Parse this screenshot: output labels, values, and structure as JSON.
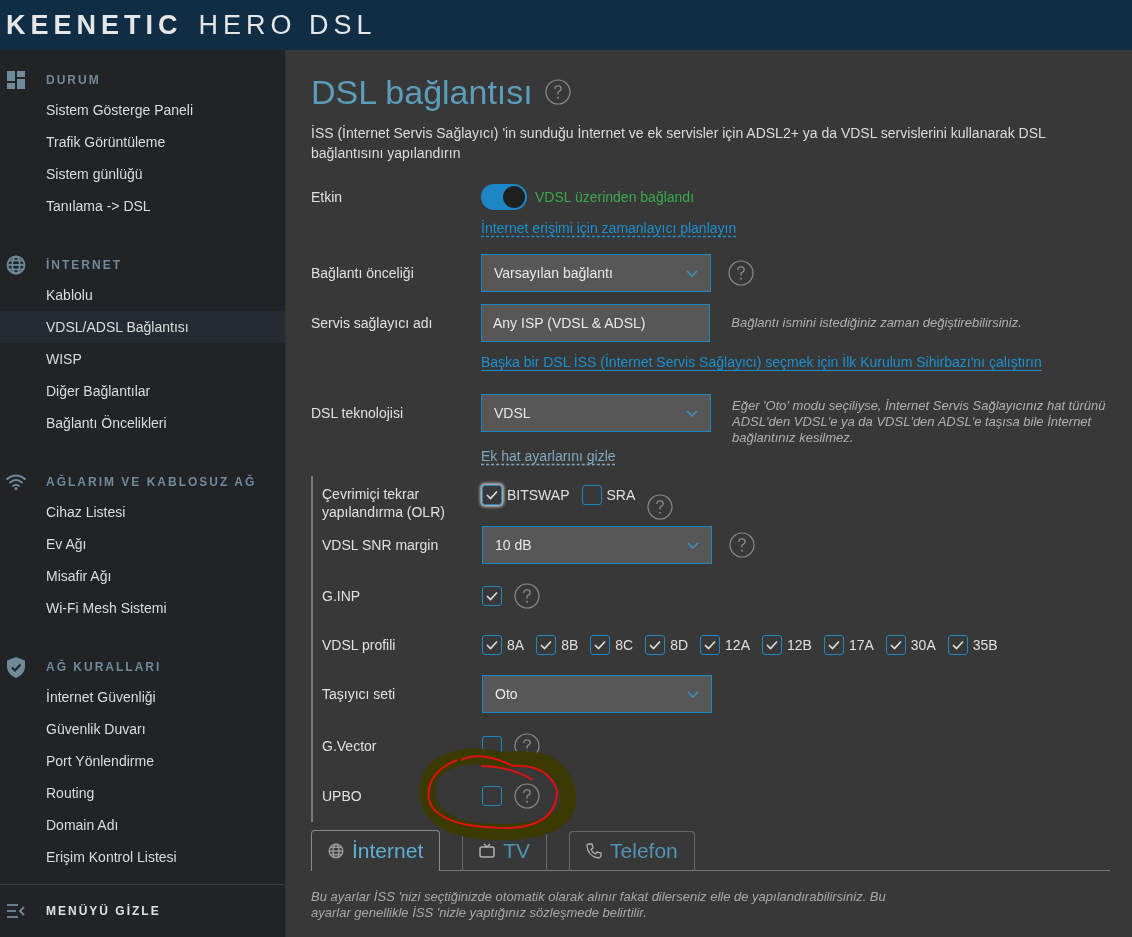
{
  "header": {
    "brand": "KEENETIC",
    "model": "HERO DSL"
  },
  "sidebar": {
    "sections": [
      {
        "heading": "DURUM",
        "items": [
          {
            "label": "Sistem Gösterge Paneli",
            "selected": false
          },
          {
            "label": "Trafik Görüntüleme",
            "selected": false
          },
          {
            "label": "Sistem günlüğü",
            "selected": false
          },
          {
            "label": "Tanılama -> DSL",
            "selected": false
          }
        ]
      },
      {
        "heading": "İNTERNET",
        "items": [
          {
            "label": "Kablolu",
            "selected": false
          },
          {
            "label": "VDSL/ADSL Bağlantısı",
            "selected": true
          },
          {
            "label": "WISP",
            "selected": false
          },
          {
            "label": "Diğer Bağlantılar",
            "selected": false
          },
          {
            "label": "Bağlantı Öncelikleri",
            "selected": false
          }
        ]
      },
      {
        "heading": "AĞLARIM VE KABLOSUZ AĞ",
        "items": [
          {
            "label": "Cihaz Listesi",
            "selected": false
          },
          {
            "label": "Ev Ağı",
            "selected": false
          },
          {
            "label": "Misafir Ağı",
            "selected": false
          },
          {
            "label": "Wi-Fi Mesh Sistemi",
            "selected": false
          }
        ]
      },
      {
        "heading": "AĞ KURALLARI",
        "items": [
          {
            "label": "İnternet Güvenliği",
            "selected": false
          },
          {
            "label": "Güvenlik Duvarı",
            "selected": false
          },
          {
            "label": "Port Yönlendirme",
            "selected": false
          },
          {
            "label": "Routing",
            "selected": false
          },
          {
            "label": "Domain Adı",
            "selected": false
          },
          {
            "label": "Erişim Kontrol Listesi",
            "selected": false
          }
        ]
      }
    ],
    "footer": "MENÜYÜ GİZLE"
  },
  "page": {
    "title": "DSL bağlantısı",
    "title_help": true,
    "description": "İSS (İnternet Servis Sağlayıcı) 'in sunduğu İnternet ve ek servisler için ADSL2+ ya da VDSL servislerini kullanarak DSL bağlantısını yapılandırın"
  },
  "form": [
    {
      "kind": "toggle",
      "label": "Etkin",
      "on": true,
      "status": "VDSL üzerinden bağlandı"
    },
    {
      "kind": "dashed-link",
      "text": "İnternet erişimi için zamanlayıcı planlayın",
      "muted": false
    },
    {
      "kind": "select",
      "label": "Bağlantı önceliği",
      "value": "Varsayılan bağlantı",
      "help": true
    },
    {
      "kind": "input",
      "label": "Servis sağlayıcı adı",
      "value": "Any ISP (VDSL & ADSL)",
      "hint": "Bağlantı ismini istediğiniz zaman değiştirebilirsiniz."
    },
    {
      "kind": "link",
      "text": "Başka bir DSL İSS (İnternet Servis Sağlayıcı) seçmek için İlk Kurulum Sihirbazı'nı çalıştırın",
      "muted": false
    },
    {
      "kind": "select",
      "label": "DSL teknolojisi",
      "value": "VDSL",
      "hint": "Eğer 'Oto' modu seçiliyse, İnternet Servis Sağlayıcınız hat türünü ADSL'den VDSL'e ya da VDSL'den ADSL'e taşısa bile İnternet bağlantınız kesilmez."
    },
    {
      "kind": "dashed-link",
      "text": "Ek hat ayarlarını gizle",
      "muted": true
    }
  ],
  "advanced": [
    {
      "kind": "checks",
      "label": "Çevrimiçi tekrar yapılandırma (OLR)",
      "help": true,
      "options": [
        {
          "label": "BITSWAP",
          "checked": true,
          "focused": true
        },
        {
          "label": "SRA",
          "checked": false,
          "focused": false
        }
      ]
    },
    {
      "kind": "select",
      "label": "VDSL SNR margin",
      "value": "10 dB",
      "help": true
    },
    {
      "kind": "checks",
      "label": "G.INP",
      "help": true,
      "options": [
        {
          "checked": true
        }
      ]
    },
    {
      "kind": "checks",
      "label": "VDSL profili",
      "options": [
        {
          "label": "8A",
          "checked": true
        },
        {
          "label": "8B",
          "checked": true
        },
        {
          "label": "8C",
          "checked": true
        },
        {
          "label": "8D",
          "checked": true
        },
        {
          "label": "12A",
          "checked": true
        },
        {
          "label": "12B",
          "checked": true
        },
        {
          "label": "17A",
          "checked": true
        },
        {
          "label": "30A",
          "checked": true
        },
        {
          "label": "35B",
          "checked": true
        }
      ]
    },
    {
      "kind": "select",
      "label": "Taşıyıcı seti",
      "value": "Oto"
    },
    {
      "kind": "checks",
      "label": "G.Vector",
      "help": true,
      "options": [
        {
          "checked": false
        }
      ]
    },
    {
      "kind": "checks",
      "label": "UPBO",
      "help": true,
      "options": [
        {
          "checked": false
        }
      ]
    }
  ],
  "tabs": [
    {
      "label": "İnternet",
      "selected": true
    },
    {
      "label": "TV",
      "selected": false
    },
    {
      "label": "Telefon",
      "selected": false
    }
  ],
  "note": "Bu ayarlar İSS 'nizi seçtiğinizde otomatik olarak alınır fakat dilerseniz elle de yapılandırabilirsiniz. Bu ayarlar genellikle İSS 'nizle yaptığınız sözleşmede belirtilir."
}
